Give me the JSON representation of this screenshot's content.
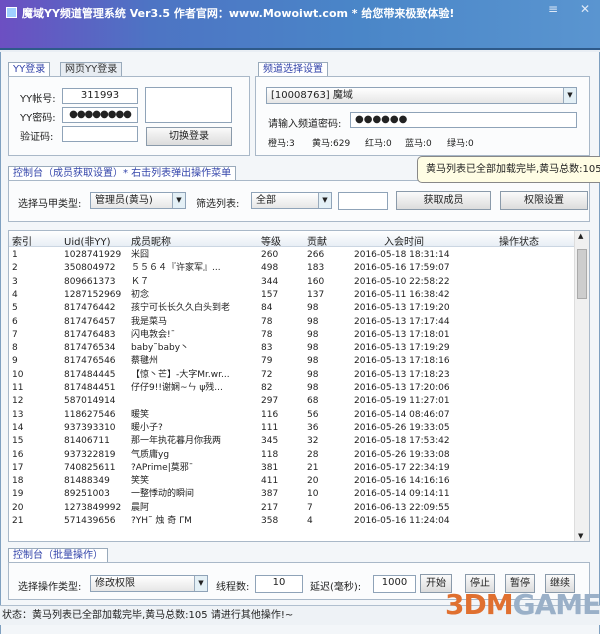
{
  "window": {
    "title": "魔域YY频道管理系统 Ver3.5   作者官网：www.Mowoiwt.com   *   给您带来极致体验!"
  },
  "login": {
    "tabs": [
      "YY登录",
      "网页YY登录"
    ],
    "account_label": "YY帐号:",
    "account_value": "311993",
    "password_label": "YY密码:",
    "password_value": "●●●●●●●●",
    "captcha_label": "验证码:",
    "captcha_value": "",
    "switch_button": "切换登录"
  },
  "channel": {
    "tab": "频道选择设置",
    "selected": "[10008763] 魔域",
    "password_label": "请输入频道密码:",
    "password_value": "●●●●●●",
    "counts": [
      "橙马:3",
      "黄马:629",
      "红马:0",
      "蓝马:0",
      "绿马:0"
    ]
  },
  "tooltip": "黄马列表已全部加载完毕,黄马总数:105",
  "control": {
    "tab": "控制台（成员获取设置）* 右击列表弹出操作菜单",
    "type_label": "选择马甲类型:",
    "type_value": "管理员(黄马)",
    "filter_label": "筛选列表:",
    "filter_value": "全部",
    "filter_text": "",
    "fetch_button": "获取成员",
    "perm_button": "权限设置"
  },
  "table": {
    "headers": [
      "索引",
      "Uid(非YY)",
      "成员昵称",
      "等级",
      "贡献",
      "入会时间",
      "操作状态"
    ],
    "rows": [
      [
        "1",
        "1028741929",
        "米囧",
        "260",
        "266",
        "2016-05-18 18:31:14",
        ""
      ],
      [
        "2",
        "350804972",
        "５５６４『许家军』...",
        "498",
        "183",
        "2016-05-16 17:59:07",
        ""
      ],
      [
        "3",
        "809661373",
        "Ｋ７",
        "344",
        "160",
        "2016-05-10 22:58:22",
        ""
      ],
      [
        "4",
        "1287152969",
        "初念",
        "157",
        "137",
        "2016-05-11 16:38:42",
        ""
      ],
      [
        "5",
        "817476442",
        "孩宁可长长久久白头到老",
        "84",
        "98",
        "2016-05-13 17:19:20",
        ""
      ],
      [
        "6",
        "817476457",
        "我是菜马",
        "78",
        "98",
        "2016-05-13 17:17:44",
        ""
      ],
      [
        "7",
        "817476483",
        "闪电敦会!¯",
        "78",
        "98",
        "2016-05-13 17:18:01",
        ""
      ],
      [
        "8",
        "817476534",
        "baby˜baby丶",
        "83",
        "98",
        "2016-05-13 17:19:29",
        ""
      ],
      [
        "9",
        "817476546",
        "蔡毽州",
        "79",
        "98",
        "2016-05-13 17:18:16",
        ""
      ],
      [
        "10",
        "817484445",
        "【惊丶芒】-大字Mr.wr...",
        "72",
        "98",
        "2016-05-13 17:18:23",
        ""
      ],
      [
        "11",
        "817484451",
        "仔仔9!!谢娴~ㄣ ψ残...",
        "82",
        "98",
        "2016-05-13 17:20:06",
        ""
      ],
      [
        "12",
        "587014914",
        "",
        "297",
        "68",
        "2016-05-19 11:27:01",
        ""
      ],
      [
        "13",
        "118627546",
        "暖笑",
        "116",
        "56",
        "2016-05-14 08:46:07",
        ""
      ],
      [
        "14",
        "937393310",
        "暖小子?",
        "111",
        "36",
        "2016-05-26 19:33:05",
        ""
      ],
      [
        "15",
        "81406711",
        "那一年执花暮月你我两",
        "345",
        "32",
        "2016-05-18 17:53:42",
        ""
      ],
      [
        "16",
        "937322819",
        "气质庸yg",
        "118",
        "28",
        "2016-05-26 19:33:08",
        ""
      ],
      [
        "17",
        "740825611",
        "?APrime|莫邪¯",
        "381",
        "21",
        "2016-05-17 22:34:19",
        ""
      ],
      [
        "18",
        "81488349",
        "笑笑",
        "411",
        "20",
        "2016-05-16 14:16:16",
        ""
      ],
      [
        "19",
        "89251003",
        "一整悸动的瞬间",
        "387",
        "10",
        "2016-05-14 09:14:11",
        ""
      ],
      [
        "20",
        "1273849992",
        "晨阿",
        "217",
        "7",
        "2016-06-13 22:09:55",
        ""
      ],
      [
        "21",
        "571439656",
        "?ΥΗ˜ 烛 奇 ΓΜ",
        "358",
        "4",
        "2016-05-16 11:24:04",
        ""
      ]
    ]
  },
  "batch": {
    "tab": "控制台（批量操作）",
    "type_label": "选择操作类型:",
    "type_value": "修改权限",
    "threads_label": "线程数:",
    "threads_value": "10",
    "delay_label": "延迟(毫秒):",
    "delay_value": "1000",
    "start": "开始",
    "stop": "停止",
    "pause": "暂停",
    "resume": "继续"
  },
  "status": "状态：黄马列表已全部加载完毕,黄马总数:105 请进行其他操作!~",
  "watermark": "3DMGAME"
}
